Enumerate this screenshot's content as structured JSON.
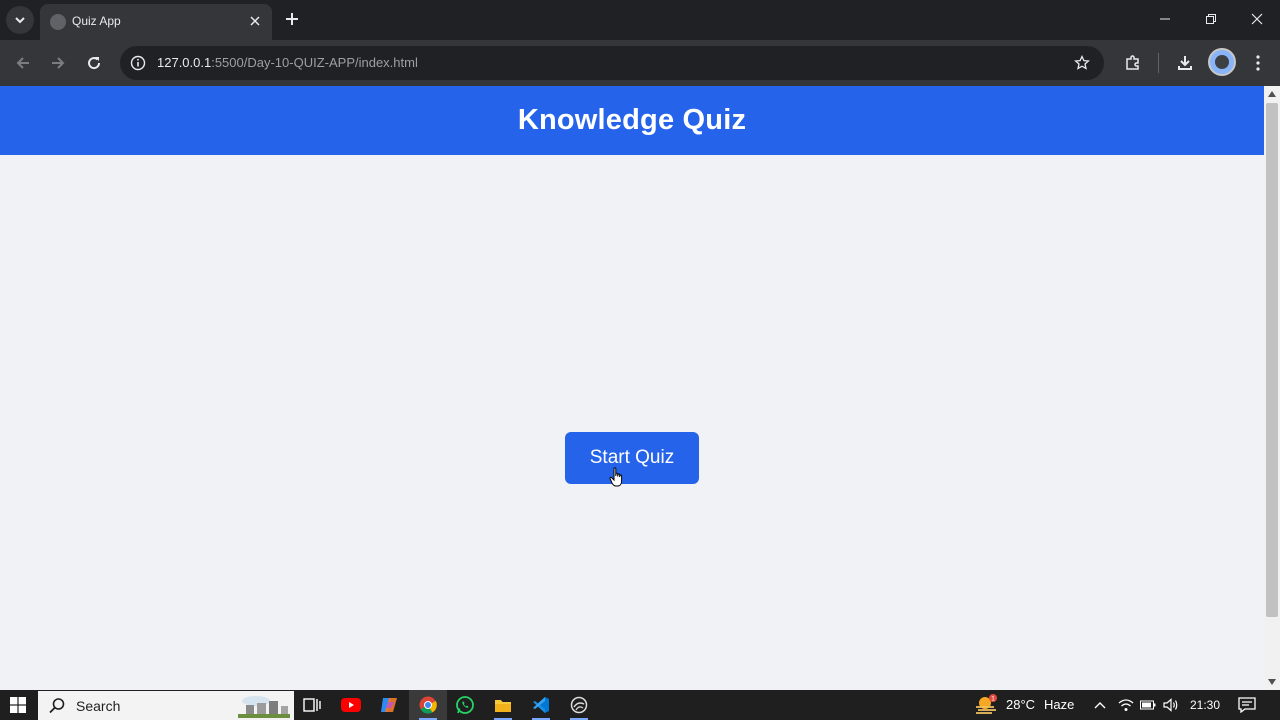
{
  "browser": {
    "tab_title": "Quiz App",
    "url_host": "127.0.0.1",
    "url_rest": ":5500/Day-10-QUIZ-APP/index.html"
  },
  "page": {
    "title": "Knowledge Quiz",
    "start_button_label": "Start Quiz",
    "header_color": "#2563eb",
    "background_color": "#f0f2f5"
  },
  "taskbar": {
    "search_placeholder": "Search",
    "apps": [
      "task-view",
      "youtube",
      "copilot",
      "chrome",
      "whatsapp",
      "file-explorer",
      "vscode",
      "edge-dev"
    ],
    "weather": {
      "temperature": "28°C",
      "condition": "Haze",
      "badge": "1"
    },
    "clock": "21:30"
  }
}
